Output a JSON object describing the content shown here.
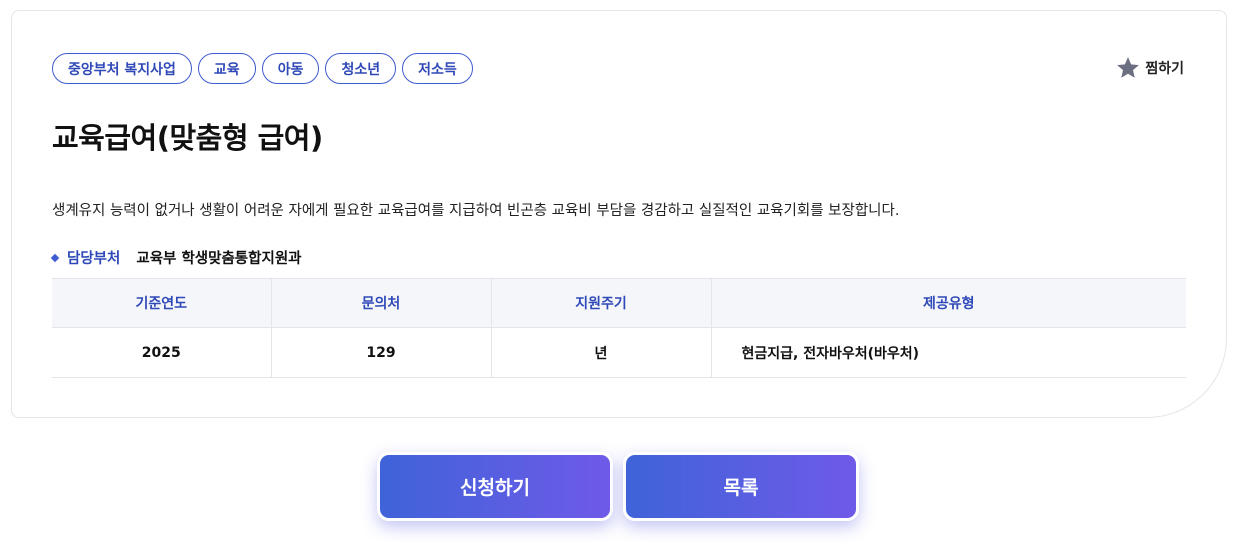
{
  "tags": [
    "중앙부처 복지사업",
    "교육",
    "아동",
    "청소년",
    "저소득"
  ],
  "favorite": {
    "label": "찜하기",
    "icon": "star-icon",
    "icon_color": "#6b6f80"
  },
  "title": "교육급여(맞춤형 급여)",
  "description": "생계유지 능력이 없거나 생활이 어려운 자에게 필요한 교육급여를 지급하여 빈곤층 교육비 부담을 경감하고 실질적인 교육기회를 보장합니다.",
  "department": {
    "label": "담당부처",
    "value": "교육부 학생맞춤통합지원과"
  },
  "table": {
    "headers": [
      "기준연도",
      "문의처",
      "지원주기",
      "제공유형"
    ],
    "row": [
      "2025",
      "129",
      "년",
      "현금지급, 전자바우처(바우처)"
    ]
  },
  "buttons": {
    "apply": "신청하기",
    "list": "목록"
  },
  "colors": {
    "accent": "#2f49b8",
    "button_start": "#3f63d9",
    "button_end": "#6f5ae8"
  }
}
